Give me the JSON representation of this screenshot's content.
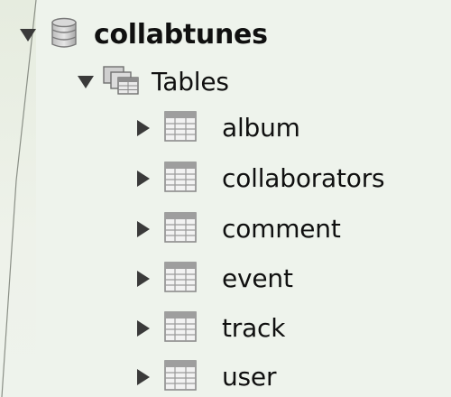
{
  "schema": {
    "name": "collabtunes",
    "expanded": true,
    "icon": "database-icon"
  },
  "tables_folder": {
    "label": "Tables",
    "expanded": true,
    "icon": "table-group-icon"
  },
  "tables": [
    {
      "label": "album",
      "expanded": false,
      "icon": "table-icon"
    },
    {
      "label": "collaborators",
      "expanded": false,
      "icon": "table-icon"
    },
    {
      "label": "comment",
      "expanded": false,
      "icon": "table-icon"
    },
    {
      "label": "event",
      "expanded": false,
      "icon": "table-icon"
    },
    {
      "label": "track",
      "expanded": false,
      "icon": "table-icon"
    },
    {
      "label": "user",
      "expanded": false,
      "icon": "table-icon"
    }
  ],
  "colors": {
    "background": "#eef3ec",
    "text": "#101010",
    "twisty": "#3a3a3a",
    "icon_gray": "#9a9a9a"
  }
}
